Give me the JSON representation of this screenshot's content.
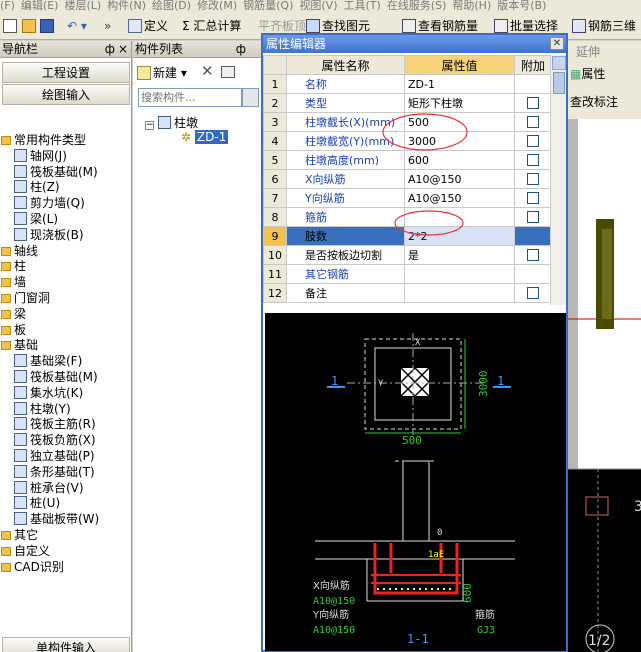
{
  "menubar": {
    "items": [
      "(F)",
      "编辑(E)",
      "楼层(L)",
      "构件(N)",
      "绘图(D)",
      "修改(M)",
      "钢筋量(Q)",
      "视图(V)",
      "工具(T)",
      "在线服务(S)",
      "帮助(H)",
      "版本号(B)"
    ]
  },
  "toolbar": {
    "define": "定义",
    "sum": "Σ 汇总计算",
    "flat": "平齐板顶",
    "find": "查找图元",
    "view_rebar": "查看钢筋量",
    "batch": "批量选择",
    "rebar3d": "钢筋三维",
    "extend": "延伸",
    "attr": "属性",
    "check_label": "查改标注"
  },
  "nav": {
    "title": "导航栏",
    "pin": "ф",
    "close": "×",
    "btn_settings": "工程设置",
    "btn_draw": "绘图输入",
    "bottom": "单构件输入"
  },
  "tree": [
    {
      "label": "常用构件类型",
      "level": 0,
      "type": "folder"
    },
    {
      "label": "轴网(J)",
      "level": 1,
      "type": "item"
    },
    {
      "label": "筏板基础(M)",
      "level": 1,
      "type": "item"
    },
    {
      "label": "柱(Z)",
      "level": 1,
      "type": "item"
    },
    {
      "label": "剪力墙(Q)",
      "level": 1,
      "type": "item"
    },
    {
      "label": "梁(L)",
      "level": 1,
      "type": "item"
    },
    {
      "label": "现浇板(B)",
      "level": 1,
      "type": "item"
    },
    {
      "label": "轴线",
      "level": 0,
      "type": "folder"
    },
    {
      "label": "柱",
      "level": 0,
      "type": "folder"
    },
    {
      "label": "墙",
      "level": 0,
      "type": "folder"
    },
    {
      "label": "门窗洞",
      "level": 0,
      "type": "folder"
    },
    {
      "label": "梁",
      "level": 0,
      "type": "folder"
    },
    {
      "label": "板",
      "level": 0,
      "type": "folder"
    },
    {
      "label": "基础",
      "level": 0,
      "type": "folder"
    },
    {
      "label": "基础梁(F)",
      "level": 1,
      "type": "item"
    },
    {
      "label": "筏板基础(M)",
      "level": 1,
      "type": "item"
    },
    {
      "label": "集水坑(K)",
      "level": 1,
      "type": "item"
    },
    {
      "label": "柱墩(Y)",
      "level": 1,
      "type": "item"
    },
    {
      "label": "筏板主筋(R)",
      "level": 1,
      "type": "item"
    },
    {
      "label": "筏板负筋(X)",
      "level": 1,
      "type": "item"
    },
    {
      "label": "独立基础(P)",
      "level": 1,
      "type": "item"
    },
    {
      "label": "条形基础(T)",
      "level": 1,
      "type": "item"
    },
    {
      "label": "桩承台(V)",
      "level": 1,
      "type": "item"
    },
    {
      "label": "桩(U)",
      "level": 1,
      "type": "item"
    },
    {
      "label": "基础板带(W)",
      "level": 1,
      "type": "item"
    },
    {
      "label": "其它",
      "level": 0,
      "type": "folder"
    },
    {
      "label": "自定义",
      "level": 0,
      "type": "folder"
    },
    {
      "label": "CAD识别",
      "level": 0,
      "type": "folder"
    }
  ],
  "list": {
    "title": "构件列表",
    "new": "新建",
    "search_placeholder": "搜索构件...",
    "root": "柱墩",
    "child": "ZD-1"
  },
  "editor": {
    "title": "属性编辑器",
    "headers": {
      "name": "属性名称",
      "value": "属性值",
      "add": "附加"
    },
    "rows": [
      {
        "n": "1",
        "name": "名称",
        "value": "ZD-1",
        "check": false,
        "blue": true
      },
      {
        "n": "2",
        "name": "类型",
        "value": "矩形下柱墩",
        "check": true,
        "blue": true
      },
      {
        "n": "3",
        "name": "柱墩截长(X)(mm)",
        "value": "500",
        "check": true,
        "blue": true
      },
      {
        "n": "4",
        "name": "柱墩截宽(Y)(mm)",
        "value": "3000",
        "check": true,
        "blue": true
      },
      {
        "n": "5",
        "name": "柱墩高度(mm)",
        "value": "600",
        "check": true,
        "blue": true
      },
      {
        "n": "6",
        "name": "X向纵筋",
        "value": "A10@150",
        "check": true,
        "blue": true
      },
      {
        "n": "7",
        "name": "Y向纵筋",
        "value": "A10@150",
        "check": true,
        "blue": true
      },
      {
        "n": "8",
        "name": "箍筋",
        "value": "",
        "check": true,
        "blue": true
      },
      {
        "n": "9",
        "name": "肢数",
        "value": "2*2",
        "check": false,
        "blue": false
      },
      {
        "n": "10",
        "name": "是否按板边切割",
        "value": "是",
        "check": true,
        "blue": false
      },
      {
        "n": "11",
        "name": "其它钢筋",
        "value": "",
        "check": false,
        "blue": true
      },
      {
        "n": "12",
        "name": "备注",
        "value": "",
        "check": true,
        "blue": false
      }
    ],
    "selected_row": "9"
  },
  "cad": {
    "dim_x": "500",
    "dim_y": "3000",
    "label_x": "X",
    "label_y": "Y",
    "sec_left": "1",
    "sec_right": "1",
    "zero": "0",
    "lae": "1aE",
    "h600": "600",
    "x_rebar_label": "X向纵筋",
    "x_rebar": "A10@150",
    "y_rebar_label": "Y向纵筋",
    "y_rebar": "A10@150",
    "stirrup_label": "箍筋",
    "stirrup": "GJ3",
    "section": "1-1"
  },
  "right": {
    "a": "3",
    "b": "1/2"
  }
}
